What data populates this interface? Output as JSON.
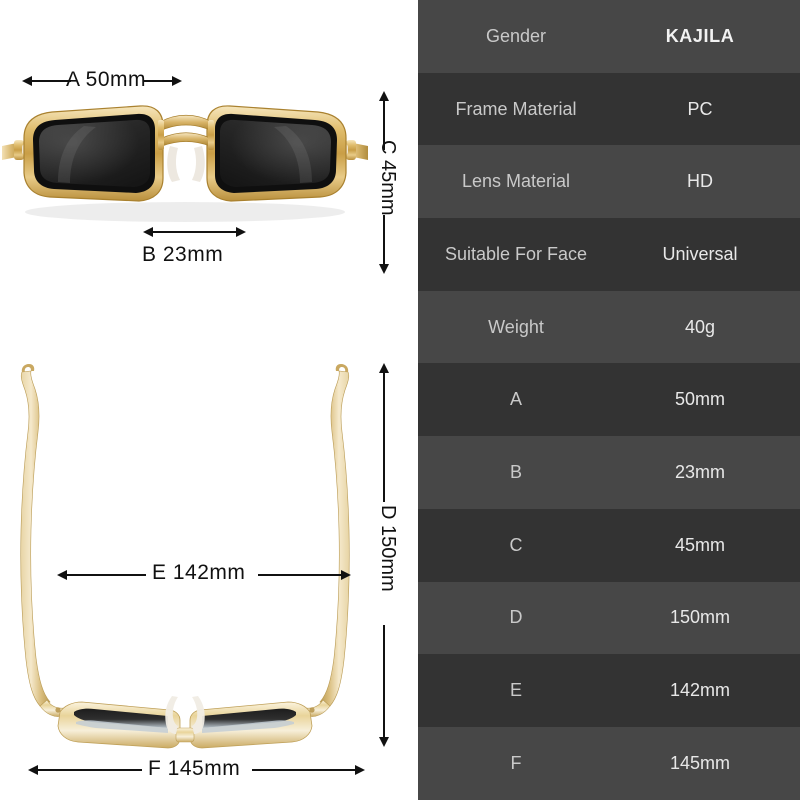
{
  "product": {
    "brand": "KAJILA",
    "view_top_label": "front-view",
    "view_bottom_label": "top-down-view"
  },
  "diagram": {
    "front_view": {
      "measurements": [
        {
          "letter": "A",
          "value": "50",
          "unit": "mm",
          "orientation": "horizontal",
          "position": "above-left-lens"
        },
        {
          "letter": "B",
          "value": "23",
          "unit": "mm",
          "orientation": "horizontal",
          "position": "below-bridge"
        },
        {
          "letter": "C",
          "value": "45",
          "unit": "mm",
          "orientation": "vertical",
          "position": "right-side"
        }
      ]
    },
    "top_view": {
      "measurements": [
        {
          "letter": "D",
          "value": "150",
          "unit": "mm",
          "orientation": "vertical",
          "position": "right-side"
        },
        {
          "letter": "E",
          "value": "142",
          "unit": "mm",
          "orientation": "horizontal",
          "position": "middle"
        },
        {
          "letter": "F",
          "value": "145",
          "unit": "mm",
          "orientation": "horizontal",
          "position": "bottom"
        }
      ]
    }
  },
  "spec_table": {
    "rows": [
      {
        "label": "Gender",
        "value": "KAJILA",
        "emphasis": true
      },
      {
        "label": "Frame Material",
        "value": "PC",
        "emphasis": false
      },
      {
        "label": "Lens Material",
        "value": "HD",
        "emphasis": false
      },
      {
        "label": "Suitable For Face",
        "value": "Universal",
        "emphasis": false
      },
      {
        "label": "Weight",
        "value": "40g",
        "emphasis": false
      },
      {
        "label": "A",
        "value": "50mm",
        "emphasis": false
      },
      {
        "label": "B",
        "value": "23mm",
        "emphasis": false
      },
      {
        "label": "C",
        "value": "45mm",
        "emphasis": false
      },
      {
        "label": "D",
        "value": "150mm",
        "emphasis": false
      },
      {
        "label": "E",
        "value": "142mm",
        "emphasis": false
      },
      {
        "label": "F",
        "value": "145mm",
        "emphasis": false
      }
    ]
  },
  "labels": {
    "a_text": "A  50mm",
    "b_text": "B  23mm",
    "c_text": "C  45mm",
    "d_text": "D  150mm",
    "e_text": "E  142mm",
    "f_text": "F  145mm"
  },
  "colors": {
    "background": "#ffffff",
    "table_row_light": "#474747",
    "table_row_dark": "#333333",
    "label_text": "#c9c9c9",
    "value_text": "#e8e8e8",
    "dimension_line": "#111111",
    "frame_gold": "#d9b15e",
    "frame_gold_light": "#f2dfae",
    "lens_dark": "#2b2b2b"
  }
}
